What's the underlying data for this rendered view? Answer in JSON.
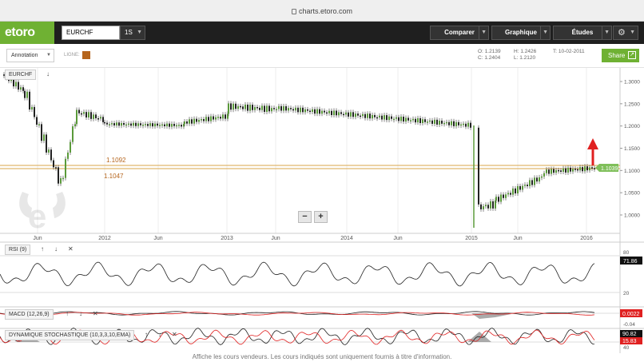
{
  "browser": {
    "url": "charts.etoro.com"
  },
  "header": {
    "logo": "etoro",
    "symbol": "EURCHF",
    "timeframe": "1S",
    "menu": [
      {
        "label": "Comparer"
      },
      {
        "label": "Graphique"
      },
      {
        "label": "Études"
      }
    ]
  },
  "toolbar": {
    "annotation_label": "Annotation",
    "line_label": "LIGNE:",
    "line_color": "#b5651d",
    "ohlc": {
      "o_label": "O:",
      "o": "1.2139",
      "c_label": "C:",
      "c": "1.2404",
      "h_label": "H:",
      "h": "1.2426",
      "l_label": "L:",
      "l": "1.2120",
      "t_label": "T:",
      "t": "10-02-2011"
    },
    "share_label": "Share"
  },
  "main_chart": {
    "symbol_label": "EURCHF",
    "level_1": "1.1092",
    "level_2": "1.1047",
    "last_price": "1.1039",
    "y_ticks": [
      "1.3000",
      "1.2500",
      "1.2000",
      "1.1500",
      "1.1000",
      "1.0500",
      "1.0000"
    ],
    "x_ticks": [
      "Jun",
      "2012",
      "Jun",
      "2013",
      "Jun",
      "2014",
      "Jun",
      "2015",
      "Jun",
      "2016"
    ],
    "zoom_out": "−",
    "zoom_in": "+"
  },
  "rsi": {
    "label": "RSI (9)",
    "value": "71.86",
    "lvl_80": "80",
    "lvl_20": "20"
  },
  "macd": {
    "label": "MACD (12,26,9)",
    "value": "0.0022",
    "lvl": "-0.04"
  },
  "stoch": {
    "label": "DYNAMIQUE STOCHASTIQUE (10,3,3,10,EMA)",
    "value_1": "90.82",
    "value_2": "15.83",
    "lvl": "40"
  },
  "footer": {
    "disclaimer": "Affiche les cours vendeurs. Les cours indiqués sont uniquement fournis à titre d'information."
  },
  "colors": {
    "brand": "#6fb133",
    "bull": "#5a9a3a",
    "bear": "#222222",
    "accent_line": "#d9a54a",
    "alert": "#e02020",
    "price_badge": "#7fbf5a"
  }
}
